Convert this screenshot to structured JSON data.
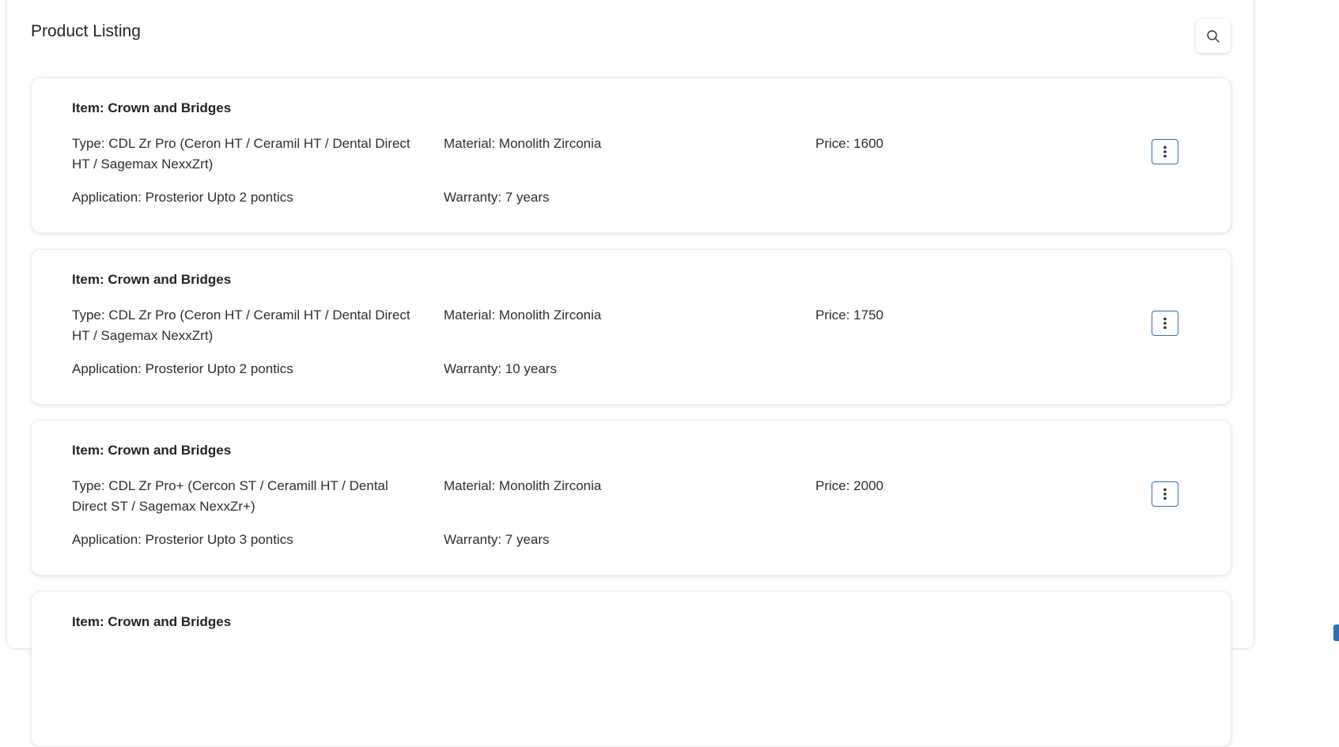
{
  "header": {
    "title": "Product Listing",
    "search_icon": "search-icon"
  },
  "products": [
    {
      "item": "Item: Crown and Bridges",
      "type": "Type: CDL Zr Pro (Ceron HT / Ceramil HT / Dental Direct HT / Sagemax NexxZrt)",
      "material": "Material: Monolith Zirconia",
      "price": "Price: 1600",
      "application": "Application: Prosterior Upto 2 pontics",
      "warranty": "Warranty: 7 years"
    },
    {
      "item": "Item: Crown and Bridges",
      "type": "Type: CDL Zr Pro (Ceron HT / Ceramil HT / Dental Direct HT / Sagemax NexxZrt)",
      "material": "Material: Monolith Zirconia",
      "price": "Price: 1750",
      "application": "Application: Prosterior Upto 2 pontics",
      "warranty": "Warranty: 10 years"
    },
    {
      "item": "Item: Crown and Bridges",
      "type": "Type: CDL Zr Pro+ (Cercon ST / Ceramill HT / Dental Direct ST / Sagemax NexxZr+)",
      "material": "Material: Monolith Zirconia",
      "price": "Price: 2000",
      "application": "Application: Prosterior Upto 3 pontics",
      "warranty": "Warranty: 7 years"
    },
    {
      "item": "Item: Crown and Bridges"
    }
  ],
  "colors": {
    "accent": "#2f6fb5",
    "text": "#1f2328",
    "card_border": "#eceef1"
  }
}
